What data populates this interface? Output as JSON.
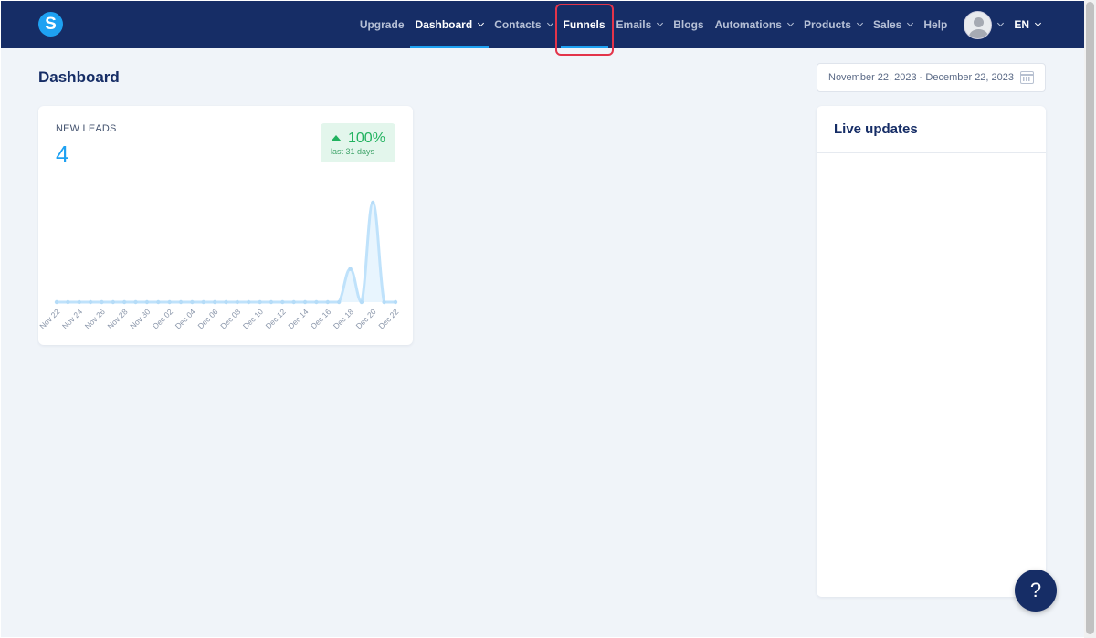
{
  "app": {
    "logo_letter": "S"
  },
  "nav": {
    "items": [
      {
        "label": "Upgrade",
        "dropdown": false
      },
      {
        "label": "Dashboard",
        "dropdown": true
      },
      {
        "label": "Contacts",
        "dropdown": true
      },
      {
        "label": "Funnels",
        "dropdown": false
      },
      {
        "label": "Emails",
        "dropdown": true
      },
      {
        "label": "Blogs",
        "dropdown": false
      },
      {
        "label": "Automations",
        "dropdown": true
      },
      {
        "label": "Products",
        "dropdown": true
      },
      {
        "label": "Sales",
        "dropdown": true
      },
      {
        "label": "Help",
        "dropdown": false
      }
    ],
    "language": "EN"
  },
  "page": {
    "title": "Dashboard",
    "date_range": "November 22, 2023 - December 22, 2023"
  },
  "leads_card": {
    "label": "NEW LEADS",
    "value": "4",
    "change": "100%",
    "change_period": "last 31 days"
  },
  "live_updates": {
    "title": "Live updates"
  },
  "help_button": {
    "label": "?"
  },
  "colors": {
    "nav_bg": "#162d66",
    "accent": "#1ea1f2",
    "positive": "#21b25f",
    "highlight": "#e3344a"
  },
  "chart_data": {
    "type": "line",
    "x": [
      "Nov 22",
      "Nov 23",
      "Nov 24",
      "Nov 25",
      "Nov 26",
      "Nov 27",
      "Nov 28",
      "Nov 29",
      "Nov 30",
      "Dec 01",
      "Dec 02",
      "Dec 03",
      "Dec 04",
      "Dec 05",
      "Dec 06",
      "Dec 07",
      "Dec 08",
      "Dec 09",
      "Dec 10",
      "Dec 11",
      "Dec 12",
      "Dec 13",
      "Dec 14",
      "Dec 15",
      "Dec 16",
      "Dec 17",
      "Dec 18",
      "Dec 19",
      "Dec 20",
      "Dec 21",
      "Dec 22"
    ],
    "tick_labels": [
      "Nov 22",
      "Nov 24",
      "Nov 26",
      "Nov 28",
      "Nov 30",
      "Dec 02",
      "Dec 04",
      "Dec 06",
      "Dec 08",
      "Dec 10",
      "Dec 12",
      "Dec 14",
      "Dec 16",
      "Dec 18",
      "Dec 20",
      "Dec 22"
    ],
    "series": [
      {
        "values": [
          0,
          0,
          0,
          0,
          0,
          0,
          0,
          0,
          0,
          0,
          0,
          0,
          0,
          0,
          0,
          0,
          0,
          0,
          0,
          0,
          0,
          0,
          0,
          0,
          0,
          0,
          1,
          0,
          3,
          0,
          0
        ]
      }
    ],
    "ylim": [
      0,
      3
    ],
    "grid": false
  }
}
